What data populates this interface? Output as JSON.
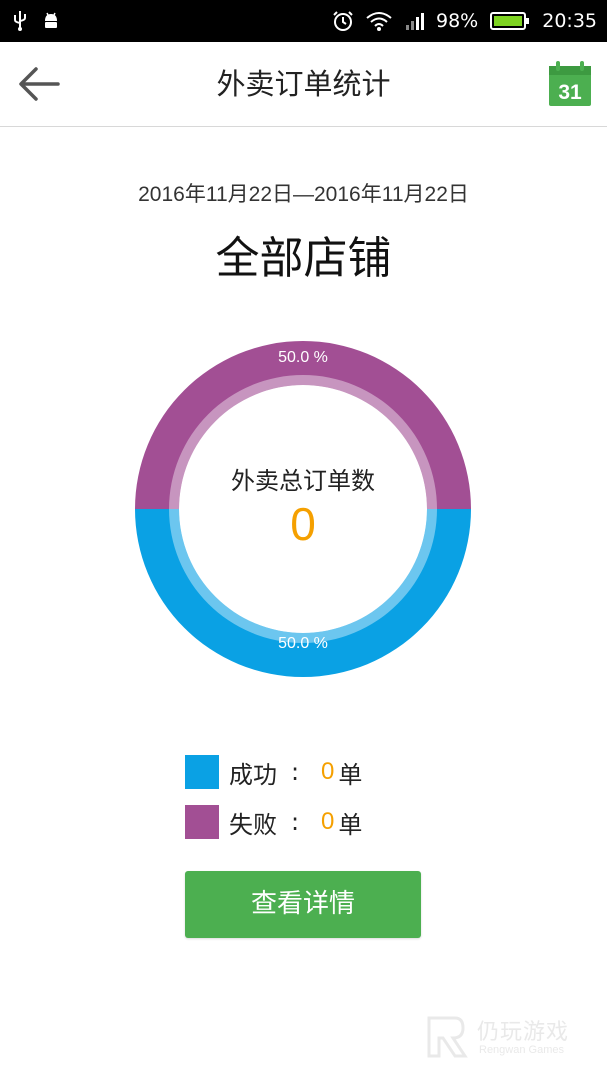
{
  "status_bar": {
    "battery_percent": "98%",
    "time": "20:35",
    "icons": [
      "usb-icon",
      "android-icon",
      "alarm-icon",
      "wifi-icon",
      "signal-icon",
      "battery-icon"
    ]
  },
  "app_bar": {
    "title": "外卖订单统计",
    "back_icon": "arrow-left-icon",
    "calendar_icon": "calendar-icon",
    "calendar_day": "31"
  },
  "summary": {
    "date_range": "2016年11月22日—2016年11月22日",
    "store": "全部店铺"
  },
  "chart_data": {
    "type": "pie",
    "categories": [
      "成功",
      "失败"
    ],
    "values": [
      50.0,
      50.0
    ],
    "labels": [
      "50.0 %",
      "50.0 %"
    ],
    "colors": [
      "#0aa1e4",
      "#a24f94"
    ],
    "center_label": "外卖总订单数",
    "center_value": "0"
  },
  "legend": [
    {
      "label": "成功",
      "colon": ":",
      "count": "0",
      "unit": "单",
      "color": "#0aa1e4"
    },
    {
      "label": "失败",
      "colon": ":",
      "count": "0",
      "unit": "单",
      "color": "#a24f94"
    }
  ],
  "actions": {
    "detail_label": "查看详情"
  },
  "watermark": {
    "text": "仍玩游戏",
    "sub": "Rengwan Games"
  },
  "colors": {
    "accent_green": "#4caf50",
    "count_orange": "#f5a000"
  }
}
